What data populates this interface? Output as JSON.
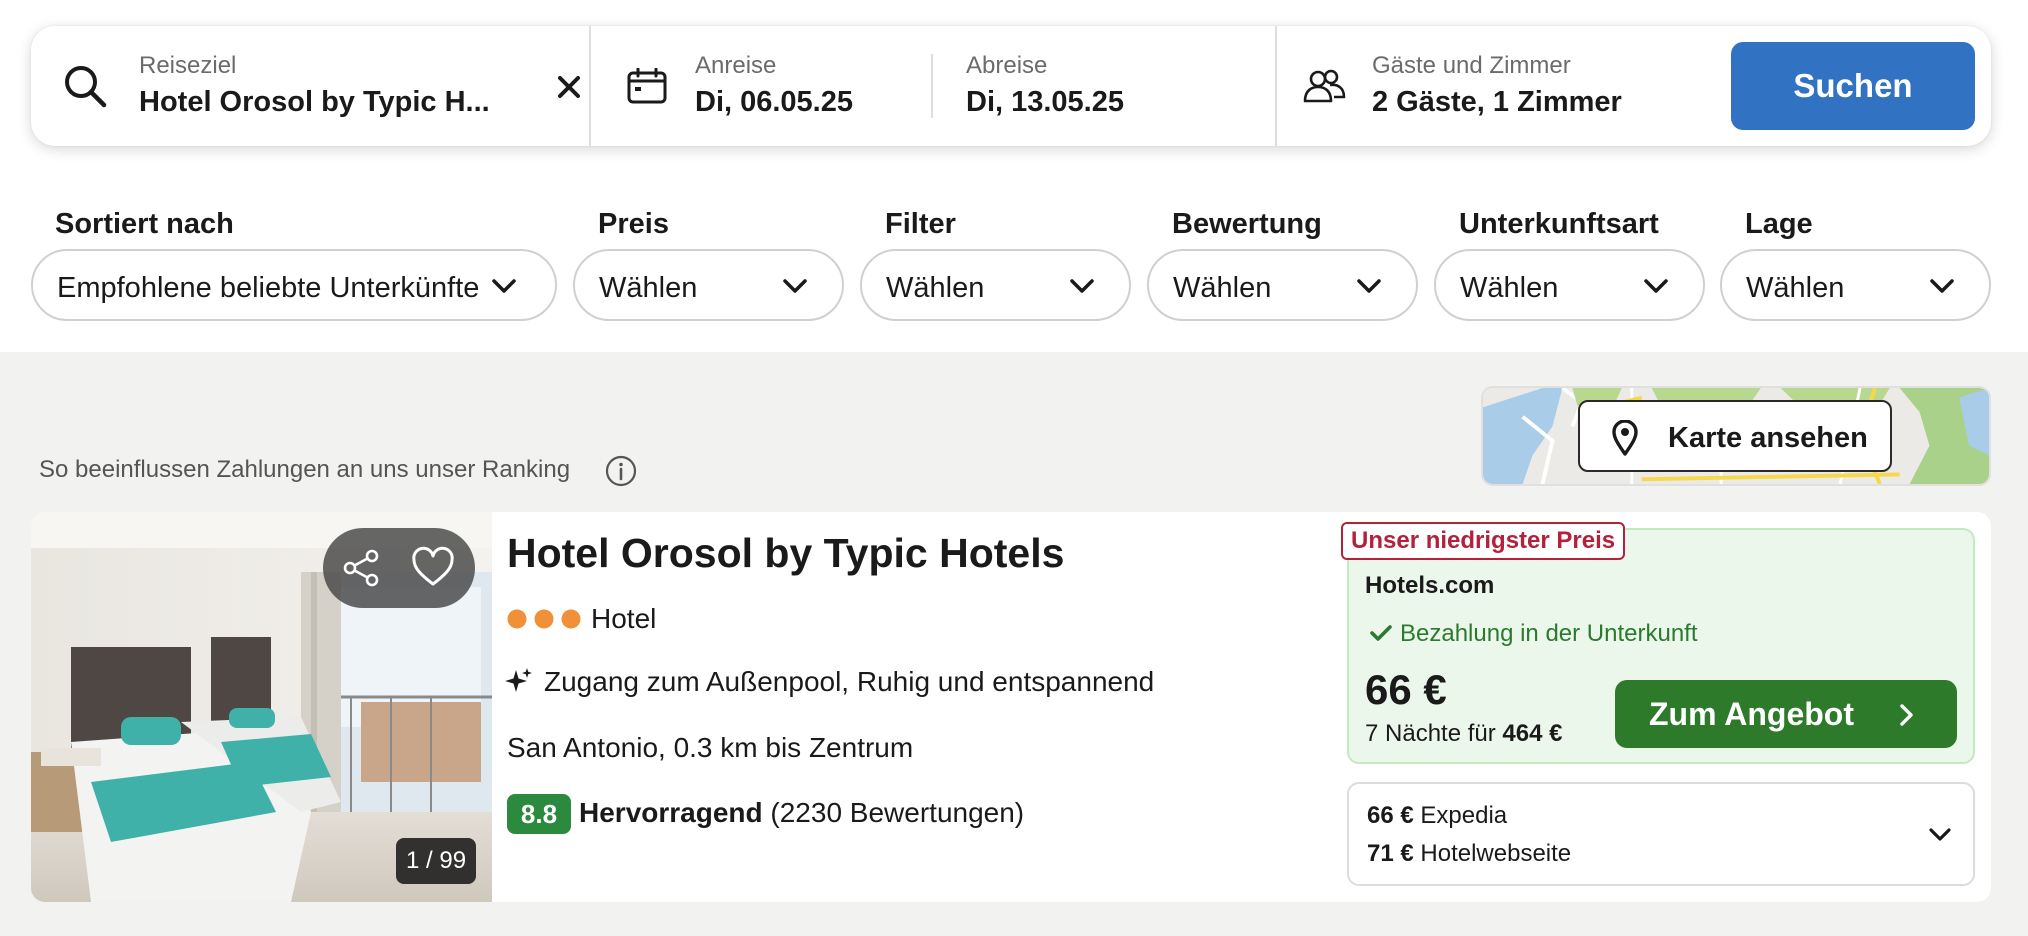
{
  "search": {
    "destination_label": "Reiseziel",
    "destination_value": "Hotel Orosol by Typic H...",
    "checkin_label": "Anreise",
    "checkin_value": "Di, 06.05.25",
    "checkout_label": "Abreise",
    "checkout_value": "Di, 13.05.25",
    "guests_label": "Gäste und Zimmer",
    "guests_value": "2 Gäste, 1 Zimmer",
    "search_button": "Suchen"
  },
  "filters": [
    {
      "label": "Sortiert nach",
      "value": "Empfohlene beliebte Unterkünfte"
    },
    {
      "label": "Preis",
      "value": "Wählen"
    },
    {
      "label": "Filter",
      "value": "Wählen"
    },
    {
      "label": "Bewertung",
      "value": "Wählen"
    },
    {
      "label": "Unterkunftsart",
      "value": "Wählen"
    },
    {
      "label": "Lage",
      "value": "Wählen"
    }
  ],
  "results": {
    "ranking_note": "So beeinflussen Zahlungen an uns unser Ranking",
    "map_button": "Karte ansehen"
  },
  "hotel": {
    "name": "Hotel Orosol by Typic Hotels",
    "star_rating": 3,
    "type": "Hotel",
    "amenities": "Zugang zum Außenpool, Ruhig und entspannend",
    "location": "San Antonio, 0.3 km bis Zentrum",
    "rating_score": "8.8",
    "rating_label": "Hervorragend",
    "rating_count": "(2230 Bewertungen)",
    "photo_counter": "1 / 99",
    "deal": {
      "badge": "Unser niedrigster Preis",
      "provider": "Hotels.com",
      "payment_note": "Bezahlung in der Unterkunft",
      "price": "66 €",
      "nights_text": "7 Nächte für",
      "total_price": "464 €",
      "button": "Zum Angebot"
    },
    "other_offers": [
      {
        "price": "66 €",
        "provider": "Expedia"
      },
      {
        "price": "71 €",
        "provider": "Hotelwebseite"
      }
    ]
  },
  "colors": {
    "primary_blue": "#3173c2",
    "deal_green": "#2c7a2a",
    "rating_green": "#2b8a3e",
    "badge_red": "#b4213b",
    "star_orange": "#f0913a"
  },
  "icons": [
    "search-icon",
    "close-icon",
    "calendar-icon",
    "guests-icon",
    "chevron-down-icon",
    "info-icon",
    "map-pin-icon",
    "share-icon",
    "heart-icon",
    "sparkle-icon",
    "checkmark-icon",
    "chevron-right-icon"
  ]
}
